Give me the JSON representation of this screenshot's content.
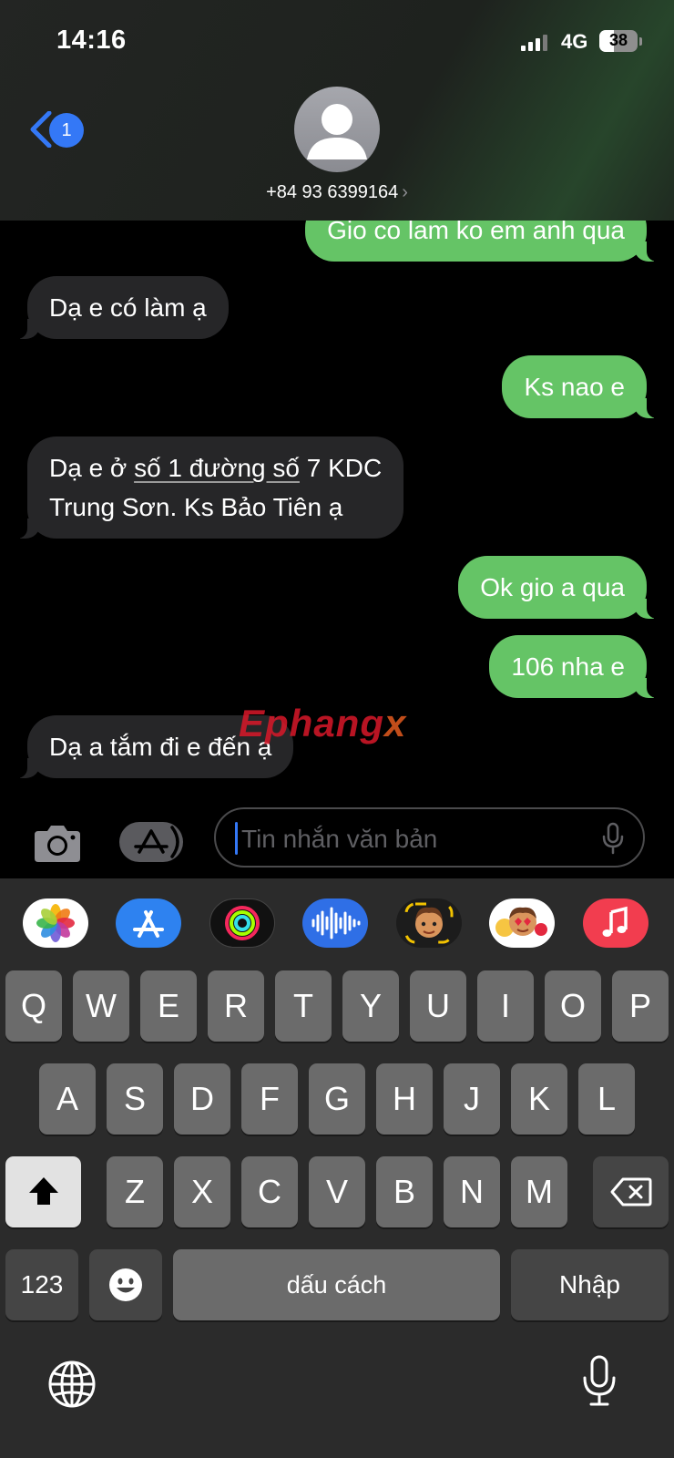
{
  "status_bar": {
    "time": "14:16",
    "network": "4G",
    "battery": "38",
    "battery_level": 0.38
  },
  "header": {
    "back_badge": "1",
    "contact_name": "+84 93 6399164",
    "chevron": "›"
  },
  "messages": [
    {
      "side": "out",
      "text": "Gio co lam ko em anh qua"
    },
    {
      "side": "in",
      "text": "Dạ e có làm ạ"
    },
    {
      "side": "out",
      "text": "Ks nao e"
    },
    {
      "side": "in",
      "line1_pre": "Dạ e ở ",
      "line1_link": "số 1 đường số",
      "line1_post": " 7 KDC",
      "line2": "Trung Sơn. Ks Bảo Tiên ạ"
    },
    {
      "side": "out",
      "text": "Ok gio a qua"
    },
    {
      "side": "out",
      "text": "106 nha e"
    },
    {
      "side": "in",
      "text": "Dạ a tắm đi e đến ạ"
    }
  ],
  "watermark": {
    "part1": "Ephang",
    "part2": "x"
  },
  "composer": {
    "placeholder": "Tin nhắn văn bản"
  },
  "app_strip": [
    "photos-icon",
    "app-store-icon",
    "fitness-icon",
    "audio-message-icon",
    "memoji-icon",
    "animoji-stickers-icon",
    "music-icon"
  ],
  "keyboard": {
    "row1": [
      "Q",
      "W",
      "E",
      "R",
      "T",
      "Y",
      "U",
      "I",
      "O",
      "P"
    ],
    "row2": [
      "A",
      "S",
      "D",
      "F",
      "G",
      "H",
      "J",
      "K",
      "L"
    ],
    "row3": [
      "Z",
      "X",
      "C",
      "V",
      "B",
      "N",
      "M"
    ],
    "numbers_key": "123",
    "space_key": "dấu cách",
    "return_key": "Nhập"
  },
  "colors": {
    "outgoing_bubble": "#65c466",
    "incoming_bubble": "#262628",
    "accent": "#3478f6"
  }
}
